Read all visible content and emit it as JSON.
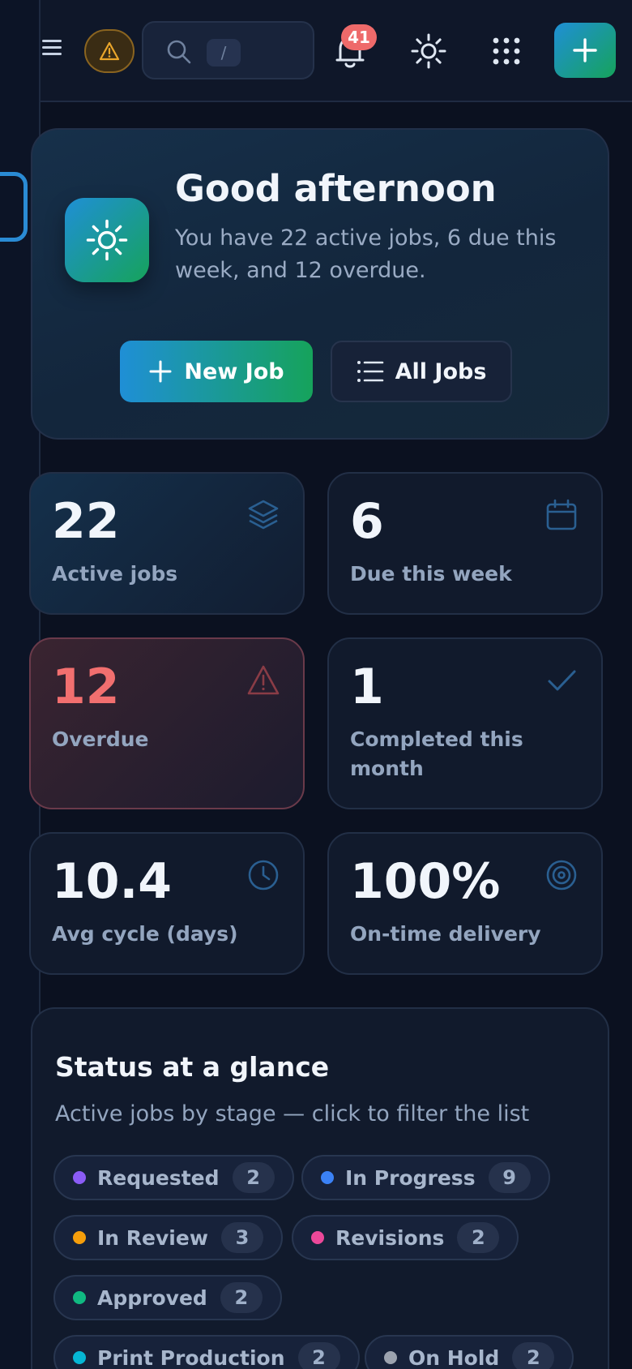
{
  "topbar": {
    "search_shortcut": "/",
    "notifications_count": "41"
  },
  "hero": {
    "greeting": "Good afternoon",
    "summary": "You have 22 active jobs, 6 due this week, and 12 overdue.",
    "new_job_label": "New Job",
    "all_jobs_label": "All Jobs"
  },
  "stats": [
    {
      "value": "22",
      "label": "Active jobs",
      "icon": "layers-icon"
    },
    {
      "value": "6",
      "label": "Due this week",
      "icon": "calendar-icon"
    },
    {
      "value": "12",
      "label": "Overdue",
      "icon": "warning-icon"
    },
    {
      "value": "1",
      "label": "Completed this month",
      "icon": "check-icon"
    },
    {
      "value": "10.4",
      "label": "Avg cycle (days)",
      "icon": "clock-icon"
    },
    {
      "value": "100%",
      "label": "On-time delivery",
      "icon": "target-icon"
    }
  ],
  "status": {
    "title": "Status at a glance",
    "subtitle": "Active jobs by stage — click to filter the list",
    "stages": [
      {
        "label": "Requested",
        "count": "2",
        "color": "#8b5cf6"
      },
      {
        "label": "In Progress",
        "count": "9",
        "color": "#3b82f6"
      },
      {
        "label": "In Review",
        "count": "3",
        "color": "#f59e0b"
      },
      {
        "label": "Revisions",
        "count": "2",
        "color": "#ec4899"
      },
      {
        "label": "Approved",
        "count": "2",
        "color": "#10b981"
      },
      {
        "label": "Print Production",
        "count": "2",
        "color": "#06b6d4"
      },
      {
        "label": "On Hold",
        "count": "2",
        "color": "#9ca3af"
      }
    ]
  },
  "colors": {
    "accent_gradient_start": "#1f8fd6",
    "accent_gradient_end": "#16a35b",
    "danger": "#f26f6f",
    "background": "#0b1120"
  }
}
